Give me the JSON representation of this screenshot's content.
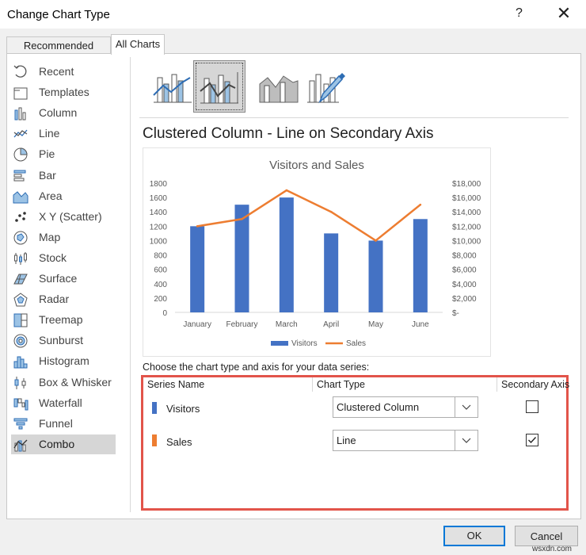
{
  "window": {
    "title": "Change Chart Type",
    "help": "?",
    "close": "✕"
  },
  "tabs": [
    {
      "label": "Recommended Charts"
    },
    {
      "label": "All Charts"
    }
  ],
  "sidebar": {
    "items": [
      {
        "label": "Recent"
      },
      {
        "label": "Templates"
      },
      {
        "label": "Column"
      },
      {
        "label": "Line"
      },
      {
        "label": "Pie"
      },
      {
        "label": "Bar"
      },
      {
        "label": "Area"
      },
      {
        "label": "X Y (Scatter)"
      },
      {
        "label": "Map"
      },
      {
        "label": "Stock"
      },
      {
        "label": "Surface"
      },
      {
        "label": "Radar"
      },
      {
        "label": "Treemap"
      },
      {
        "label": "Sunburst"
      },
      {
        "label": "Histogram"
      },
      {
        "label": "Box & Whisker"
      },
      {
        "label": "Waterfall"
      },
      {
        "label": "Funnel"
      },
      {
        "label": "Combo"
      }
    ],
    "selected": "Combo"
  },
  "main": {
    "chart_type_title": "Clustered Column - Line on Secondary Axis"
  },
  "chart_data": {
    "type": "bar",
    "title": "Visitors and Sales",
    "categories": [
      "January",
      "February",
      "March",
      "April",
      "May",
      "June"
    ],
    "series": [
      {
        "name": "Visitors",
        "type": "bar",
        "axis": "primary",
        "values": [
          1200,
          1500,
          1600,
          1100,
          1000,
          1300
        ],
        "color": "#4472c4"
      },
      {
        "name": "Sales",
        "type": "line",
        "axis": "secondary",
        "values": [
          12000,
          13000,
          17000,
          14000,
          10000,
          15000
        ],
        "color": "#ed7d31"
      }
    ],
    "y_ticks": [
      "0",
      "200",
      "400",
      "600",
      "800",
      "1000",
      "1200",
      "1400",
      "1600",
      "1800"
    ],
    "y2_ticks": [
      "$-",
      "$2,000",
      "$4,000",
      "$6,000",
      "$8,000",
      "$10,000",
      "$12,000",
      "$14,000",
      "$16,000",
      "$18,000"
    ],
    "ylim": [
      0,
      1800
    ],
    "y2lim": [
      0,
      18000
    ],
    "legend": "bottom",
    "grid": false
  },
  "series_table": {
    "instruction": "Choose the chart type and axis for your data series:",
    "headers": {
      "name": "Series Name",
      "type": "Chart Type",
      "axis": "Secondary Axis"
    },
    "rows": [
      {
        "name": "Visitors",
        "chart_type": "Clustered Column",
        "secondary": false,
        "color": "#4472c4"
      },
      {
        "name": "Sales",
        "chart_type": "Line",
        "secondary": true,
        "color": "#ed7d31"
      }
    ]
  },
  "buttons": {
    "ok": "OK",
    "cancel": "Cancel"
  },
  "watermark": "wsxdn.com"
}
